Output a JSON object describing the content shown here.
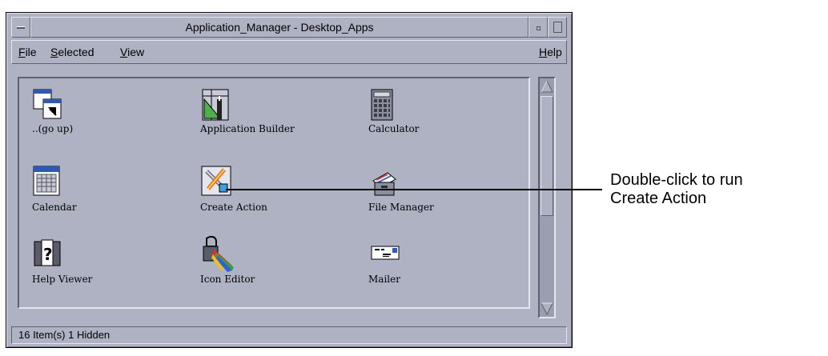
{
  "window": {
    "title": "Application_Manager - Desktop_Apps",
    "menu": {
      "file": {
        "mnemonic": "F",
        "rest": "ile"
      },
      "selected": {
        "mnemonic": "S",
        "rest": "elected"
      },
      "view": {
        "mnemonic": "V",
        "rest": "iew"
      },
      "help": {
        "mnemonic": "H",
        "rest": "elp"
      }
    },
    "status": "16 Item(s) 1 Hidden"
  },
  "icons": [
    {
      "label": "..(go up)",
      "icon": "folder-up-icon"
    },
    {
      "label": "Application Builder",
      "icon": "app-builder-icon"
    },
    {
      "label": "Calculator",
      "icon": "calculator-icon"
    },
    {
      "label": "Calendar",
      "icon": "calendar-icon"
    },
    {
      "label": "Create Action",
      "icon": "create-action-icon"
    },
    {
      "label": "File Manager",
      "icon": "file-manager-icon"
    },
    {
      "label": "Help Viewer",
      "icon": "help-viewer-icon"
    },
    {
      "label": "Icon Editor",
      "icon": "icon-editor-icon"
    },
    {
      "label": "Mailer",
      "icon": "mailer-icon"
    }
  ],
  "callout": {
    "line1": "Double-click to run",
    "line2": "Create Action"
  }
}
